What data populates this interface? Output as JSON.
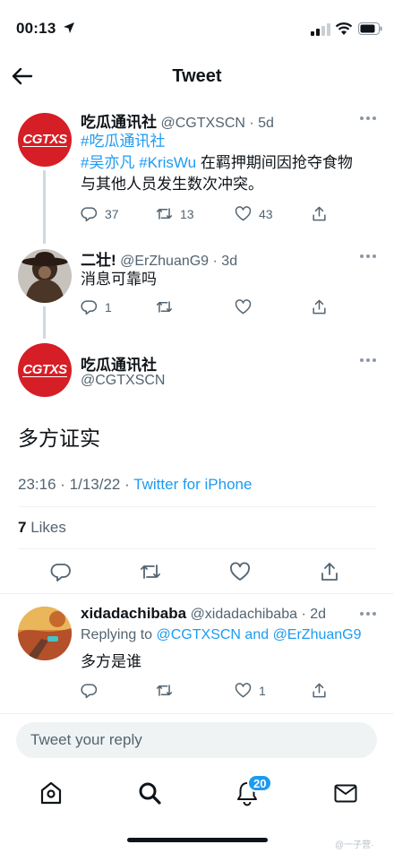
{
  "status_bar": {
    "time": "00:13"
  },
  "nav": {
    "title": "Tweet"
  },
  "thread": [
    {
      "avatar_text": "CGTXS",
      "name": "吃瓜通讯社",
      "handle": "@CGTXSCN",
      "time": "· 5d",
      "hashtag1": "#吃瓜通讯社",
      "hashtag2": "#吴亦凡",
      "hashtag3": "#KrisWu",
      "text_after": " 在羁押期间因抢夺食物",
      "text_line2": "与其他人员发生数次冲突。",
      "replies": "37",
      "retweets": "13",
      "likes": "43"
    },
    {
      "name": "二壮!",
      "handle": "@ErZhuanG9",
      "time": "· 3d",
      "text": "消息可靠吗",
      "replies": "1",
      "retweets": "",
      "likes": ""
    }
  ],
  "main_tweet": {
    "avatar_text": "CGTXS",
    "name": "吃瓜通讯社",
    "handle": "@CGTXSCN",
    "text": "多方证实",
    "timestamp": "23:16 · 1/13/22 · ",
    "source": "Twitter for iPhone",
    "likes_count": "7",
    "likes_label": " Likes"
  },
  "reply": {
    "name": "xidadachibaba",
    "handle": "@xidadachibaba",
    "time": "· 2d",
    "replying_to_label": "Replying to ",
    "mention1": "@CGTXSCN",
    "and_label": " and ",
    "mention2": "@ErZhuanG9",
    "text": "多方是谁",
    "replies": "",
    "retweets": "",
    "likes": "1"
  },
  "reply_bar": {
    "placeholder": "Tweet your reply"
  },
  "tabbar": {
    "notification_count": "20"
  },
  "watermark": "@一子营·",
  "colors": {
    "accent": "#1d9bf0",
    "cgtxs_red": "#d61e26",
    "text_primary": "#0f1419",
    "text_secondary": "#536471"
  }
}
